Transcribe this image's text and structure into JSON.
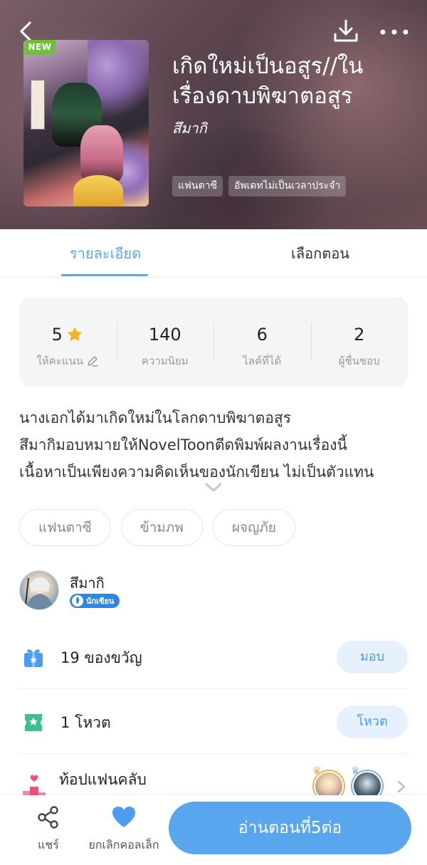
{
  "header": {
    "new_badge": "NEW",
    "title": "เกิดใหม่เป็นอสูร//ในเรื่องดาบพิฆาตอสูร",
    "title_line1": "เกิดใหม่เป็นอสูร//ใน",
    "title_line2": "เรื่องดาบพิฆาตอสูร",
    "author": "สึมากิ",
    "tags": [
      "แฟนตาซี",
      "อัพเดทไม่เป็นเวลาประจำ"
    ],
    "icons": {
      "back": "back-arrow-icon",
      "download": "download-icon",
      "more": "more-dots-icon"
    }
  },
  "tabs": {
    "details": "รายละเอียด",
    "episodes": "เลือกตอน",
    "active": "details"
  },
  "stats": [
    {
      "value": "5",
      "label": "ให้คะแนน",
      "icon": "star-icon"
    },
    {
      "value": "140",
      "label": "ความนิยม"
    },
    {
      "value": "6",
      "label": "ไลค์ที่ได้"
    },
    {
      "value": "2",
      "label": "ผู้ชื่นชอบ"
    }
  ],
  "description": [
    "นางเอกได้มาเกิดใหม่ในโลกดาบพิฆาตอสูร",
    "สึมากิมอบหมายให้NovelToonตีดพิมพ์ผลงานเรื่องนี้",
    "เนื้อหาเป็นเพียงความคิดเห็นของนักเขียน ไม่เป็นตัวแทน"
  ],
  "genres": [
    "แฟนตาซี",
    "ข้ามภพ",
    "ผจญภัย"
  ],
  "author_section": {
    "name": "สึมากิ",
    "badge": "นักเขียน"
  },
  "gift": {
    "label": "19 ของขวัญ",
    "button": "มอบ"
  },
  "vote": {
    "label": "1 โหวต",
    "button": "โหวต"
  },
  "fanclub": {
    "label": "ท้อปแฟนคลับ"
  },
  "bottom": {
    "share": "แชร์",
    "favorite": "ยกเลิกคอลเล็ก",
    "read": "อ่านตอนที่5ต่อ"
  },
  "colors": {
    "accent": "#5aa6ee",
    "tab_active": "#5aa6e8",
    "new_badge": "#6fbf3c",
    "star": "#f5b324"
  }
}
